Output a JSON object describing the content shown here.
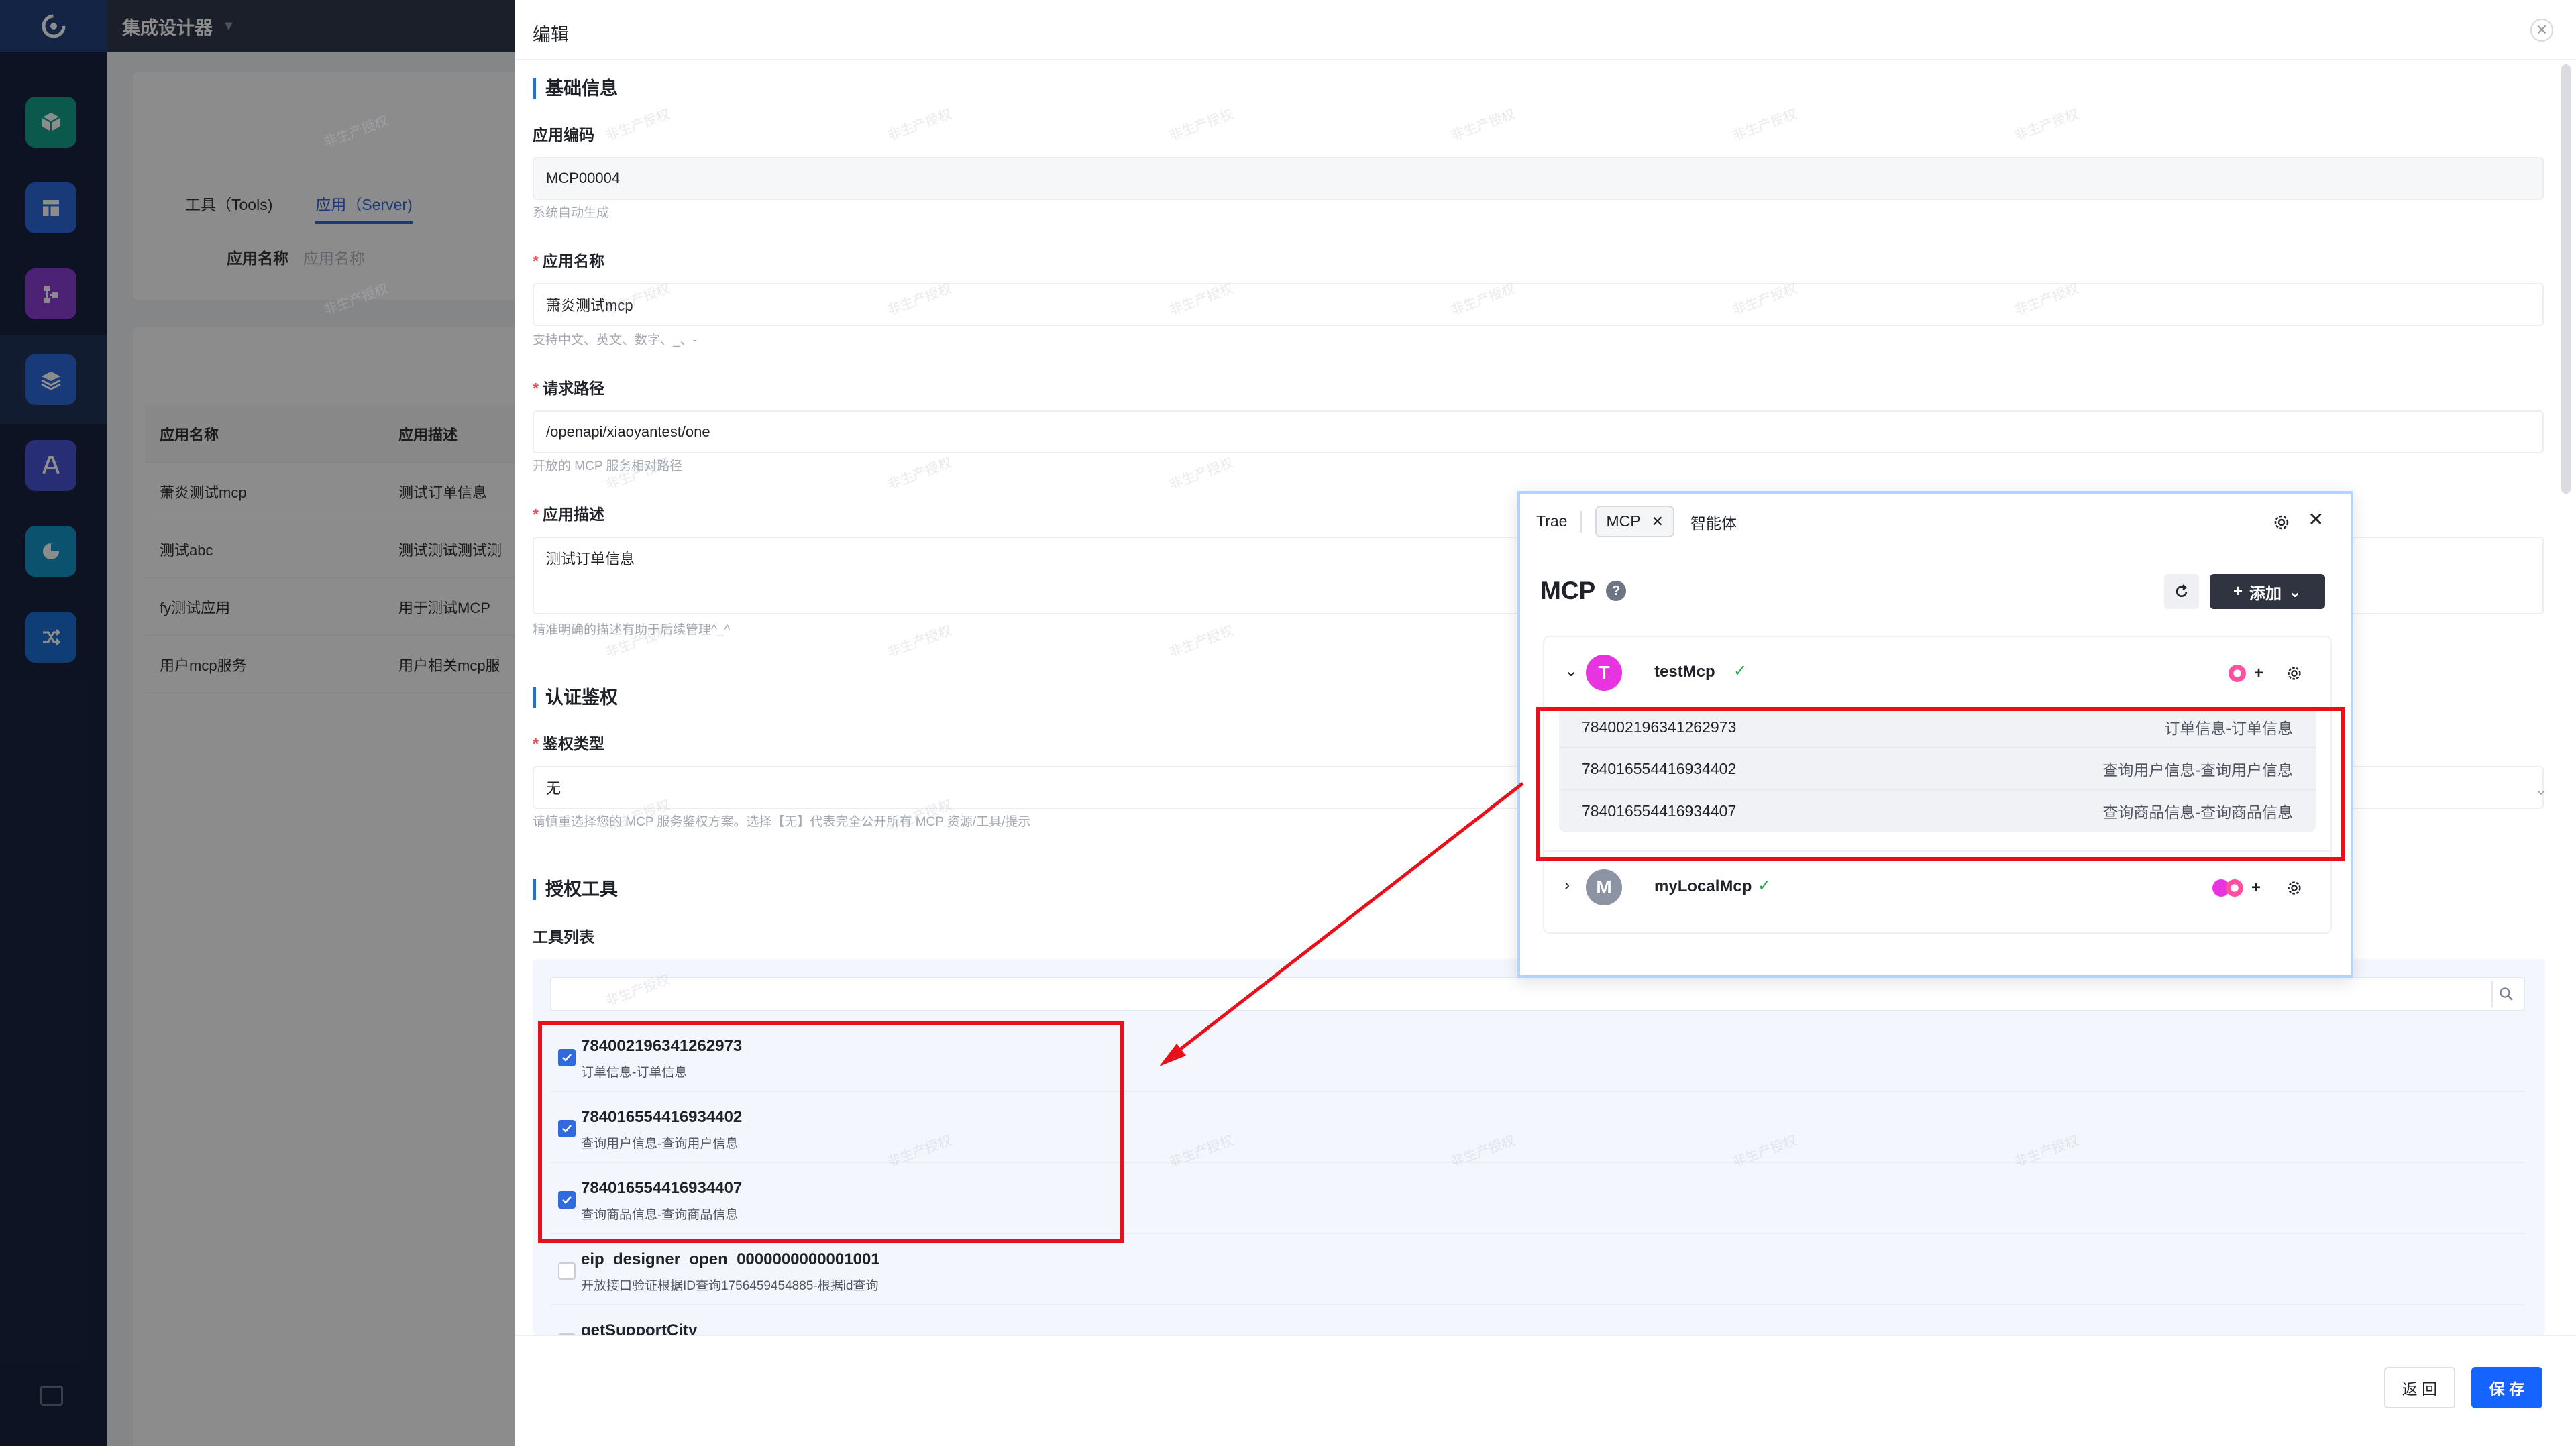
{
  "app": {
    "title": "集成设计器"
  },
  "background": {
    "tabs": [
      "工具（Tools)",
      "应用（Server)"
    ],
    "filter": {
      "label": "应用名称",
      "placeholder": "应用名称"
    },
    "table": {
      "headers": [
        "应用名称",
        "应用描述"
      ],
      "rows": [
        [
          "萧炎测试mcp",
          "测试订单信息"
        ],
        [
          "测试abc",
          "测试测试测试测"
        ],
        [
          "fy测试应用",
          "用于测试MCP"
        ],
        [
          "用户mcp服务",
          "用户相关mcp服"
        ]
      ]
    }
  },
  "drawer": {
    "title": "编辑",
    "sections": {
      "basic": "基础信息",
      "auth": "认证鉴权",
      "tools": "授权工具"
    },
    "app_code": {
      "label": "应用编码",
      "value": "MCP00004",
      "help": "系统自动生成"
    },
    "app_name": {
      "label": "应用名称",
      "value": "萧炎测试mcp",
      "help": "支持中文、英文、数字、_、-"
    },
    "path": {
      "label": "请求路径",
      "value": "/openapi/xiaoyantest/one",
      "help": "开放的 MCP 服务相对路径"
    },
    "desc": {
      "label": "应用描述",
      "value": "测试订单信息",
      "help": "精准明确的描述有助于后续管理^_^"
    },
    "auth_type": {
      "label": "鉴权类型",
      "value": "无",
      "help": "请慎重选择您的 MCP 服务鉴权方案。选择【无】代表完全公开所有 MCP 资源/工具/提示"
    },
    "tool_list_label": "工具列表",
    "tool_items": [
      {
        "name": "784002196341262973",
        "desc": "订单信息-订单信息",
        "checked": true
      },
      {
        "name": "784016554416934402",
        "desc": "查询用户信息-查询用户信息",
        "checked": true
      },
      {
        "name": "784016554416934407",
        "desc": "查询商品信息-查询商品信息",
        "checked": true
      },
      {
        "name": "eip_designer_open_0000000000001001",
        "desc": "开放接口验证根据ID查询1756459454885-根据id查询",
        "checked": false
      },
      {
        "name": "getSupportCity",
        "desc": "",
        "checked": false
      }
    ],
    "buttons": {
      "back": "返 回",
      "save": "保 存"
    }
  },
  "trae": {
    "tabs": {
      "trae": "Trae",
      "mcp": "MCP",
      "agent": "智能体"
    },
    "heading": "MCP",
    "add_label": "添加",
    "servers": [
      {
        "avatar": "T",
        "name": "testMcp",
        "avatar_color": "#e833e0",
        "expanded": true,
        "tools": [
          {
            "id": "784002196341262973",
            "desc": "订单信息-订单信息"
          },
          {
            "id": "784016554416934402",
            "desc": "查询用户信息-查询用户信息"
          },
          {
            "id": "784016554416934407",
            "desc": "查询商品信息-查询商品信息"
          }
        ]
      },
      {
        "avatar": "M",
        "name": "myLocalMcp",
        "avatar_color": "#8c93a3",
        "expanded": false,
        "tools": []
      }
    ]
  },
  "watermark_text": "非生产授权",
  "colors": {
    "primary": "#1664ff",
    "annotation": "#e8101b",
    "sidebar": "#18243f"
  }
}
